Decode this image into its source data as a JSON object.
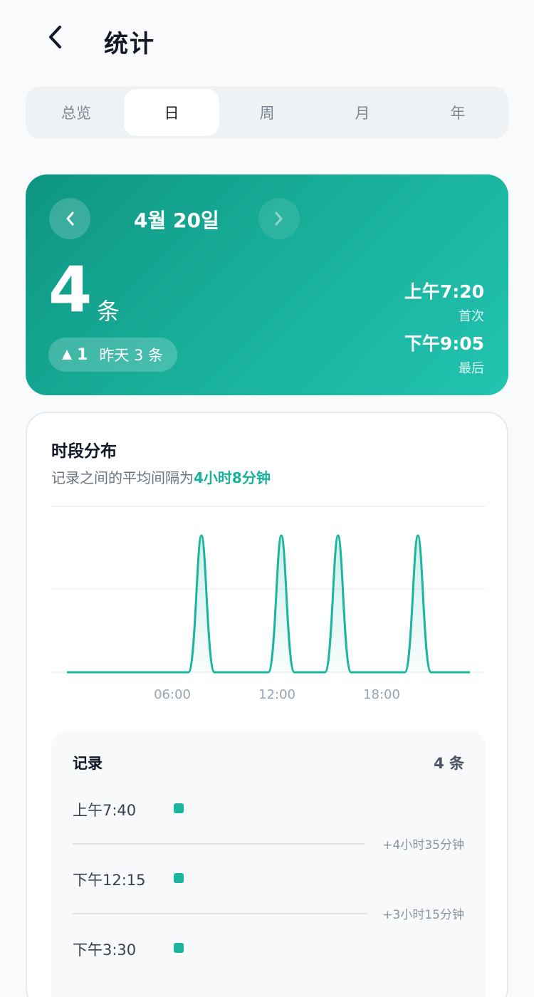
{
  "header": {
    "title": "统计",
    "back_icon": "chevron-left-icon"
  },
  "tabs": [
    {
      "label": "总览",
      "active": false
    },
    {
      "label": "日",
      "active": true
    },
    {
      "label": "周",
      "active": false
    },
    {
      "label": "月",
      "active": false
    },
    {
      "label": "年",
      "active": false
    }
  ],
  "hero": {
    "date": "4월 20일",
    "count": "4",
    "unit": "条",
    "compare": {
      "delta": "1",
      "text": "昨天 3 条",
      "icon": "triangle-up-icon"
    },
    "first": {
      "time": "上午7:20",
      "label": "首次"
    },
    "last": {
      "time": "下午9:05",
      "label": "最后"
    }
  },
  "distribution": {
    "title": "时段分布",
    "subtitle_prefix": "记录之间的平均间隔为",
    "subtitle_highlight": "4小时8分钟"
  },
  "chart_data": {
    "type": "area",
    "title": "",
    "xlabel": "",
    "ylabel": "",
    "xlim": [
      0,
      24
    ],
    "ylim": [
      0,
      1
    ],
    "x_ticks": [
      "06:00",
      "12:00",
      "18:00"
    ],
    "x_tick_values": [
      6,
      12,
      18
    ],
    "series": [
      {
        "peaks": [
          7.67,
          12.25,
          15.5,
          20.08
        ],
        "peak_value": 1
      }
    ],
    "grid": true,
    "color": "#1bb59f"
  },
  "records": {
    "title": "记录",
    "count_label": "4 条",
    "items": [
      {
        "time": "上午7:40"
      },
      {
        "time": "下午12:15"
      },
      {
        "time": "下午3:30"
      }
    ],
    "gaps": [
      "+4小时35分钟",
      "+3小时15分钟"
    ]
  },
  "colors": {
    "accent": "#1bb59f",
    "hero_start": "#0e9582",
    "hero_end": "#22c4b0"
  }
}
